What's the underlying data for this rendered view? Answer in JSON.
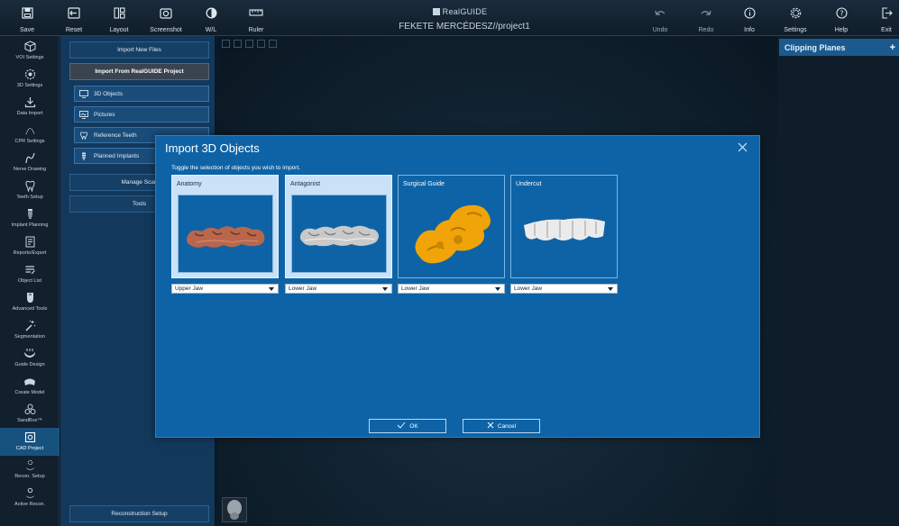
{
  "toolbar": {
    "items": [
      {
        "label": "Save",
        "icon": "save-icon"
      },
      {
        "label": "Reset",
        "icon": "reset-icon"
      },
      {
        "label": "Layout",
        "icon": "layout-icon"
      },
      {
        "label": "Screenshot",
        "icon": "camera-icon"
      },
      {
        "label": "W/L",
        "icon": "contrast-icon"
      },
      {
        "label": "Ruler",
        "icon": "ruler-icon"
      }
    ],
    "right_items": [
      {
        "label": "Undo",
        "icon": "undo-icon"
      },
      {
        "label": "Redo",
        "icon": "redo-icon"
      },
      {
        "label": "Info",
        "icon": "info-icon"
      },
      {
        "label": "Settings",
        "icon": "gear-icon"
      },
      {
        "label": "Help",
        "icon": "help-icon"
      },
      {
        "label": "Exit",
        "icon": "exit-icon"
      }
    ],
    "brand": "RealGUIDE",
    "project_title": "FEKETE MERCÉDESZ//project1"
  },
  "sidebar": {
    "items": [
      {
        "label": "VOI Settings"
      },
      {
        "label": "3D Settings"
      },
      {
        "label": "Data Import"
      },
      {
        "label": "CPR Settings"
      },
      {
        "label": "Nerve Drawing"
      },
      {
        "label": "Teeth Setup"
      },
      {
        "label": "Implant Planning"
      },
      {
        "label": "Reports/Export"
      },
      {
        "label": "Object List"
      },
      {
        "label": "Advanced Tools"
      },
      {
        "label": "Segmentation"
      },
      {
        "label": "Guide Design"
      },
      {
        "label": "Create Model"
      },
      {
        "label": "SandBox™"
      },
      {
        "label": "CAD Project"
      },
      {
        "label": "Recon. Setup"
      },
      {
        "label": "Active Recon."
      }
    ]
  },
  "panel2": {
    "import_new_files": "Import New Files",
    "import_realguide": "Import From RealGUIDE Project",
    "sub_items": [
      {
        "label": "3D Objects"
      },
      {
        "label": "Pictures"
      },
      {
        "label": "Reference Teeth"
      },
      {
        "label": "Planned Implants"
      }
    ],
    "manage_scans": "Manage Scan",
    "tools": "Tools",
    "reconstruction_setup": "Reconstruction Setup"
  },
  "right_panel": {
    "clipping_planes": "Clipping Planes"
  },
  "dialog": {
    "title": "Import 3D Objects",
    "instruction": "Toggle the selection of objects you wish to import.",
    "objects": [
      {
        "title": "Anatomy",
        "selected": true,
        "jaw": "Upper Jaw",
        "model_color": "#b5634a"
      },
      {
        "title": "Antagonist",
        "selected": true,
        "jaw": "Lower Jaw",
        "model_color": "#c8c8c8"
      },
      {
        "title": "Surgical Guide",
        "selected": false,
        "jaw": "Lower Jaw",
        "model_color": "#f0a000"
      },
      {
        "title": "Undercut",
        "selected": false,
        "jaw": "Lower Jaw",
        "model_color": "#e6e6e6"
      }
    ],
    "ok_label": "OK",
    "cancel_label": "Cancel"
  }
}
